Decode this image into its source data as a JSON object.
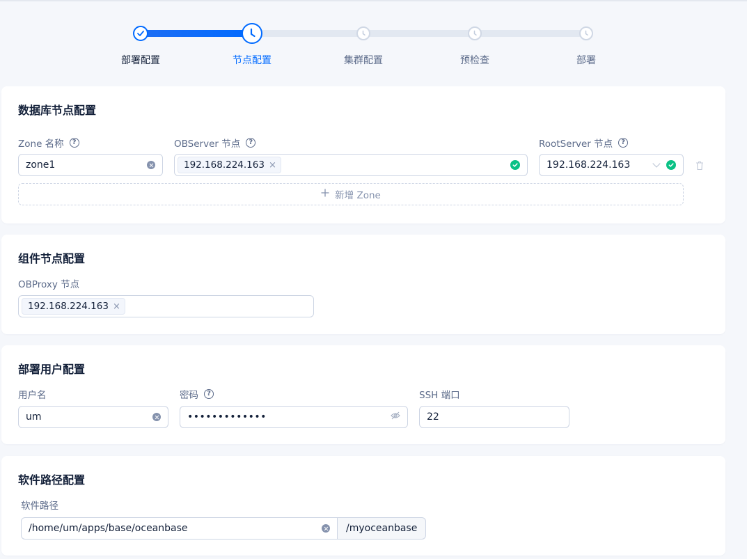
{
  "steps": [
    {
      "label": "部署配置",
      "status": "done"
    },
    {
      "label": "节点配置",
      "status": "active"
    },
    {
      "label": "集群配置",
      "status": "waiting"
    },
    {
      "label": "预检查",
      "status": "waiting"
    },
    {
      "label": "部署",
      "status": "waiting"
    }
  ],
  "db_nodes": {
    "title": "数据库节点配置",
    "zone_name_label": "Zone 名称",
    "observer_label": "OBServer 节点",
    "rootserver_label": "RootServer 节点",
    "zones": [
      {
        "zone_name": "zone1",
        "observer_tags": [
          "192.168.224.163"
        ],
        "rootserver": "192.168.224.163"
      }
    ],
    "add_zone_label": "新增 Zone"
  },
  "component_nodes": {
    "title": "组件节点配置",
    "obproxy_label": "OBProxy 节点",
    "obproxy_tags": [
      "192.168.224.163"
    ]
  },
  "deploy_user": {
    "title": "部署用户配置",
    "username_label": "用户名",
    "username_value": "um",
    "password_label": "密码",
    "password_masked": "•••••••••••••",
    "ssh_port_label": "SSH 端口",
    "ssh_port_value": "22"
  },
  "software_path": {
    "title": "软件路径配置",
    "path_label": "软件路径",
    "path_value": "/home/um/apps/base/oceanbase",
    "path_suffix": "/myoceanbase"
  },
  "colors": {
    "primary": "#006aff",
    "success": "#0ac185",
    "text": "#132039",
    "secondary_text": "#5c6b8a"
  }
}
